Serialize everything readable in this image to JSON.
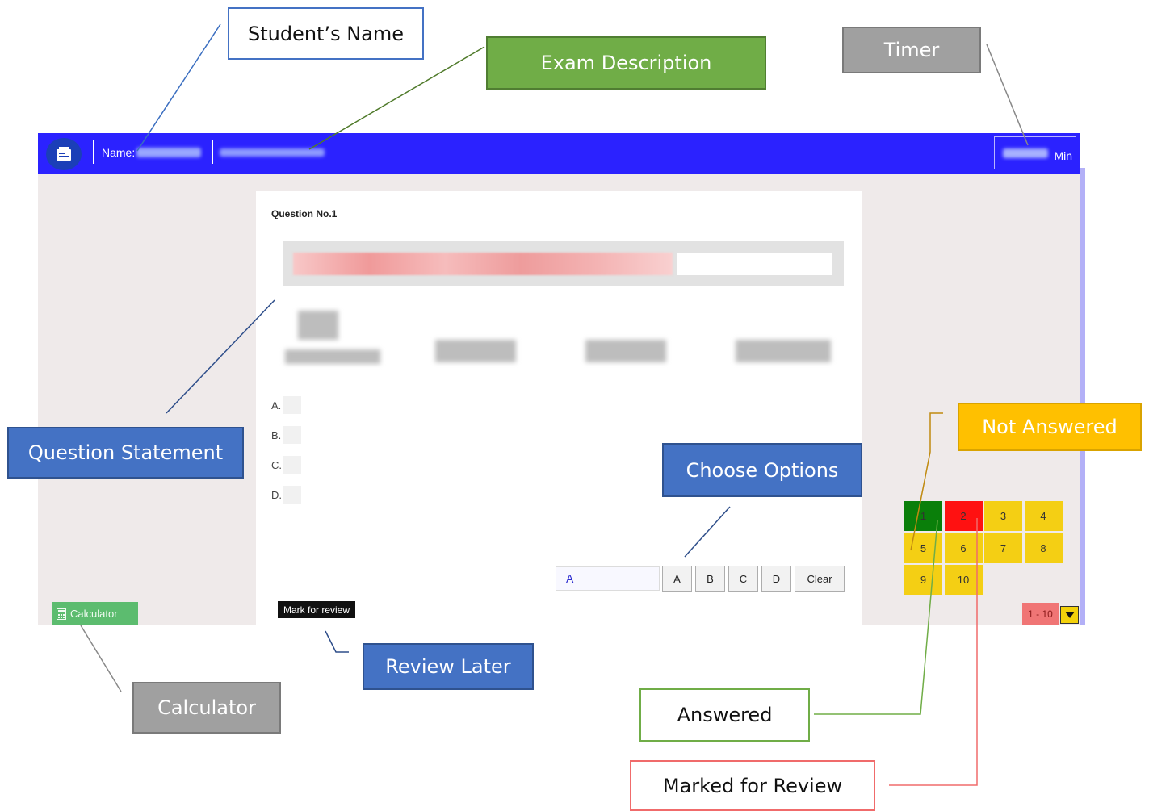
{
  "header": {
    "name_label": "Name:",
    "timer_unit": "Min"
  },
  "question": {
    "title": "Question No.1",
    "options": [
      "A.",
      "B.",
      "C.",
      "D."
    ]
  },
  "answer": {
    "selected_value": "A",
    "buttons": [
      "A",
      "B",
      "C",
      "D",
      "Clear"
    ]
  },
  "mark_for_review_label": "Mark for review",
  "calculator_label": "Calculator",
  "question_grid": {
    "cells": [
      {
        "num": "1",
        "status": "answered"
      },
      {
        "num": "2",
        "status": "marked"
      },
      {
        "num": "3",
        "status": "not-answered"
      },
      {
        "num": "4",
        "status": "not-answered"
      },
      {
        "num": "5",
        "status": "not-answered"
      },
      {
        "num": "6",
        "status": "not-answered"
      },
      {
        "num": "7",
        "status": "not-answered"
      },
      {
        "num": "8",
        "status": "not-answered"
      },
      {
        "num": "9",
        "status": "not-answered"
      },
      {
        "num": "10",
        "status": "not-answered"
      }
    ],
    "page_range": "1 - 10"
  },
  "status_colors": {
    "answered": "#0a7f0a",
    "marked": "#ff1111",
    "not-answered": "#f4cf14"
  },
  "callouts": {
    "students_name": "Student’s Name",
    "exam_description": "Exam Description",
    "timer": "Timer",
    "question_statement": "Question Statement",
    "not_answered": "Not Answered",
    "choose_options": "Choose Options",
    "review_later": "Review Later",
    "calculator": "Calculator",
    "answered": "Answered",
    "marked_for_review": "Marked for Review"
  }
}
